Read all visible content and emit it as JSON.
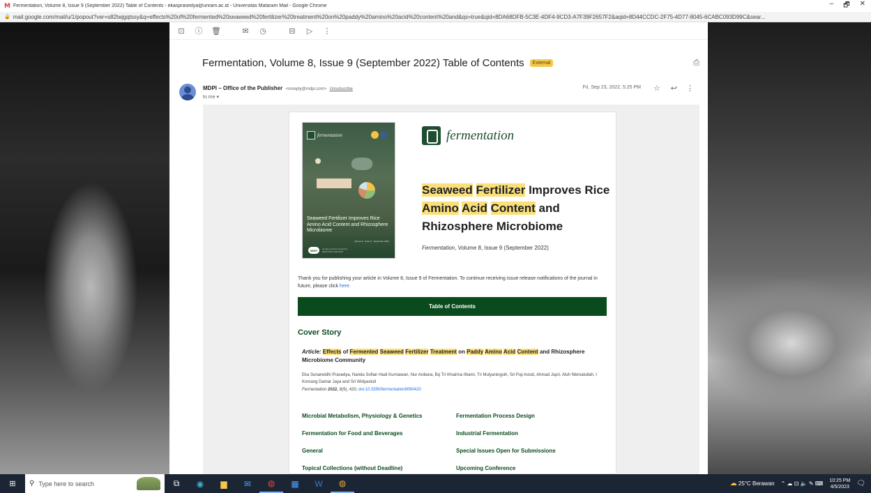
{
  "window": {
    "title": "Fermentation, Volume 8, Issue 9 (September 2022) Table of Contents - ekasprasedya@unram.ac.id - Universitas Mataram Mail - Google Chrome",
    "url": "mail.google.com/mail/u/1/popout?ver=s82twjgqtssy&q=effects%20of%20fermented%20seaweed%20fertilizer%20treatment%20on%20paddy%20amino%20acid%20content%20and&qs=true&qid=8DA68DFB-5C3E-4DF4-9CD3-A7F39F2657F2&aqid=8D44CCDC-2F75-4D77-8045-6CABC093D99C&sear...",
    "minimize": "–",
    "restore": "🗗",
    "close": "✕"
  },
  "toolbar": {
    "icons": [
      "archive-icon",
      "report-spam-icon",
      "delete-icon",
      "mark-unread-icon",
      "snooze-icon",
      "move-to-icon",
      "label-icon",
      "more-icon"
    ],
    "glyphs": [
      "⊡",
      "ⓘ",
      "🗑",
      "✉",
      "◷",
      "⊟",
      "▷",
      "⋮"
    ]
  },
  "message": {
    "subject": "Fermentation, Volume 8, Issue 9 (September 2022) Table of Contents",
    "badge": "External",
    "sender_name": "MDPI – Office of the Publisher",
    "sender_email": "<noreply@mdpi.com>",
    "unsubscribe": "Unsubscribe",
    "to": "to me ▾",
    "date": "Fri, Sep 23, 2022, 5:25 PM"
  },
  "email": {
    "cover": {
      "journal": "fermentation",
      "title": "Seaweed Fertilizer Improves Rice Amino Acid Content and Rhizosphere Microbiome",
      "volume_line": "Volume 8 · Issue 9 · September 2022",
      "publisher": "MDPI",
      "issn": "an Open Access Journal by MDPI ISSN 2311-5637"
    },
    "journal_name": "fermentation",
    "article_title_parts": [
      {
        "text": "Seaweed",
        "hl": true
      },
      {
        "text": " ",
        "hl": false
      },
      {
        "text": "Fertilizer",
        "hl": true
      },
      {
        "text": " Improves Rice ",
        "hl": false
      },
      {
        "text": "Amino",
        "hl": true
      },
      {
        "text": " ",
        "hl": false
      },
      {
        "text": "Acid",
        "hl": true
      },
      {
        "text": " ",
        "hl": false
      },
      {
        "text": "Content",
        "hl": true
      },
      {
        "text": " and Rhizosphere Microbiome",
        "hl": false
      }
    ],
    "citation_journal": "Fermentation",
    "citation_rest": ", Volume 8, Issue 9 (September 2022)",
    "thank_you": "Thank you for publishing your article in Volume 8, Issue 9 of Fermentation. To continue receiving issue release notifications of the journal in future, please click ",
    "here": "here.",
    "toc_label": "Table of Contents",
    "cover_story_label": "Cover Story",
    "story_kind": "Article:",
    "story_title_parts": [
      {
        "text": " ",
        "hl": false
      },
      {
        "text": "Effects",
        "hl": true
      },
      {
        "text": " of ",
        "hl": false
      },
      {
        "text": "Fermented",
        "hl": true
      },
      {
        "text": " ",
        "hl": false
      },
      {
        "text": "Seaweed",
        "hl": true
      },
      {
        "text": " ",
        "hl": false
      },
      {
        "text": "Fertilizer",
        "hl": true
      },
      {
        "text": " ",
        "hl": false
      },
      {
        "text": "Treatment",
        "hl": true
      },
      {
        "text": " on ",
        "hl": false
      },
      {
        "text": "Paddy",
        "hl": true
      },
      {
        "text": " ",
        "hl": false
      },
      {
        "text": "Amino",
        "hl": true
      },
      {
        "text": " ",
        "hl": false
      },
      {
        "text": "Acid",
        "hl": true
      },
      {
        "text": " ",
        "hl": false
      },
      {
        "text": "Content",
        "hl": true
      },
      {
        "text": " and Rhizosphere Microbiome Community",
        "hl": false
      }
    ],
    "authors": "Eka Sunarwidhi Prasedya, Nanda Sofian Hadi Kurniawan, Nur Ardiana, Bq Tri Khairina Ilhami, Tri Mulyaningsih, Sri Puji Astuti, Ahmad Jupri, Aluh Nikmatullah, I Komang Damar Jaya and Sri Widyastuti",
    "ref_journal": "Fermentation",
    "ref_year": "2022",
    "ref_rest": ", 8(9), 420; ",
    "ref_doi": "doi:10.3390/fermentation8090420",
    "sections": [
      "Microbial Metabolism, Physiology & Genetics",
      "Fermentation Process Design",
      "Fermentation for Food and Beverages",
      "Industrial Fermentation",
      "General",
      "Special Issues Open for Submissions",
      "Topical Collections (without Deadline)",
      "Upcoming Conference"
    ]
  },
  "taskbar": {
    "start_glyph": "⊞",
    "search_glyph": "⚲",
    "search_placeholder": "Type here to search",
    "apps": [
      {
        "name": "task-view-icon",
        "glyph": "⧉",
        "color": "#ffffff"
      },
      {
        "name": "edge-icon",
        "glyph": "◉",
        "color": "#3bb0d7"
      },
      {
        "name": "file-explorer-icon",
        "glyph": "▆",
        "color": "#f2c94c"
      },
      {
        "name": "mail-icon",
        "glyph": "✉",
        "color": "#4aa3ff"
      },
      {
        "name": "chrome-icon-1",
        "glyph": "◍",
        "color": "#e8453c"
      },
      {
        "name": "calendar-icon",
        "glyph": "▦",
        "color": "#4aa3ff"
      },
      {
        "name": "word-icon",
        "glyph": "W",
        "color": "#3a78d6"
      },
      {
        "name": "chrome-icon-2",
        "glyph": "◍",
        "color": "#e8a83c"
      }
    ],
    "weather": "25°C  Berawan",
    "tray_glyphs": "⌃  ☁  ⊡  🔈  ✎  ⌨",
    "time": "10:25 PM",
    "date": "4/5/2023",
    "notifications": "🗨"
  }
}
